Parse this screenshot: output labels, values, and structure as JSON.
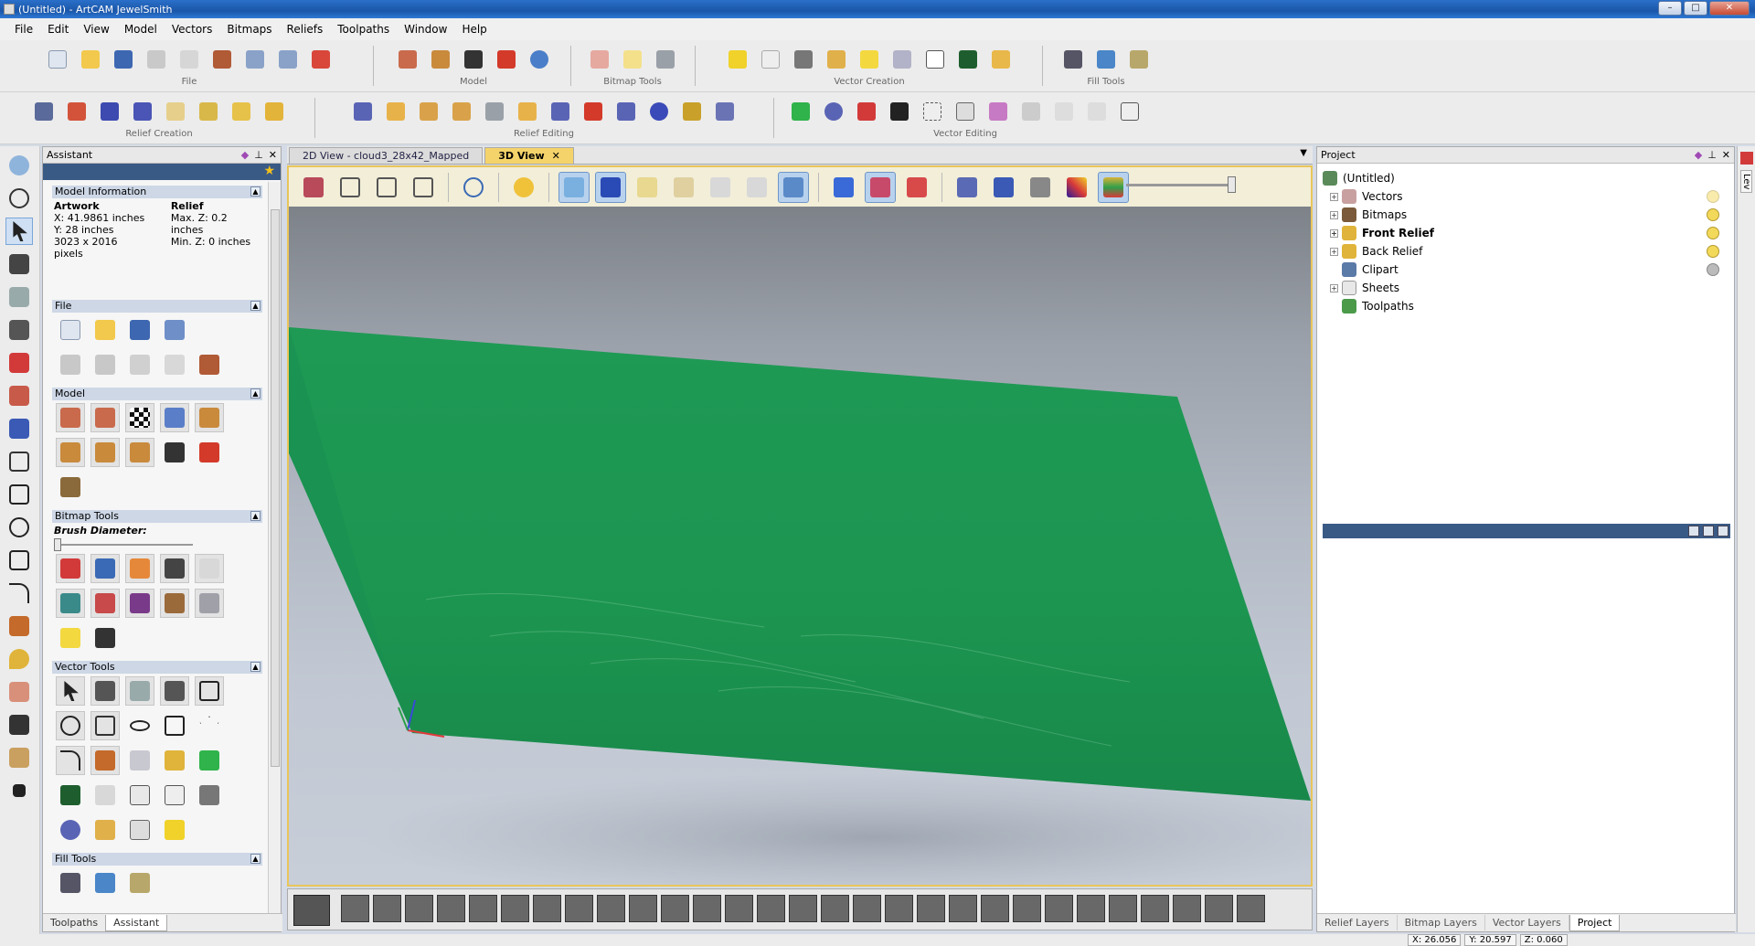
{
  "window": {
    "title": "(Untitled) - ArtCAM JewelSmith"
  },
  "menu": [
    "File",
    "Edit",
    "View",
    "Model",
    "Vectors",
    "Bitmaps",
    "Reliefs",
    "Toolpaths",
    "Window",
    "Help"
  ],
  "toolbar_groups": {
    "file": "File",
    "model": "Model",
    "bitmap_tools": "Bitmap Tools",
    "vector_creation": "Vector Creation",
    "fill_tools": "Fill Tools",
    "relief_creation": "Relief Creation",
    "relief_editing": "Relief Editing",
    "vector_editing": "Vector Editing"
  },
  "assistant": {
    "title": "Assistant",
    "model_info": {
      "heading": "Model Information",
      "artwork_label": "Artwork",
      "relief_label": "Relief",
      "x": "X: 41.9861 inches",
      "y": "Y: 28 inches",
      "pixels": "3023 x 2016 pixels",
      "max_z": "Max. Z: 0.2 inches",
      "min_z": "Min. Z: 0 inches"
    },
    "sections": {
      "file": "File",
      "model": "Model",
      "bitmap_tools": "Bitmap Tools",
      "brush_diameter": "Brush Diameter:",
      "vector_tools": "Vector Tools",
      "fill_tools": "Fill Tools"
    },
    "tabs": [
      "Toolpaths",
      "Assistant"
    ]
  },
  "view_tabs": [
    {
      "label": "2D View - cloud3_28x42_Mapped",
      "active": false
    },
    {
      "label": "3D View",
      "active": true
    }
  ],
  "project": {
    "title": "Project",
    "root": "(Untitled)",
    "items": [
      {
        "label": "Vectors",
        "bold": false
      },
      {
        "label": "Bitmaps",
        "bold": false
      },
      {
        "label": "Front Relief",
        "bold": true
      },
      {
        "label": "Back Relief",
        "bold": false
      },
      {
        "label": "Clipart",
        "bold": false
      },
      {
        "label": "Sheets",
        "bold": false
      },
      {
        "label": "Toolpaths",
        "bold": false
      }
    ],
    "tabs": [
      "Relief Layers",
      "Bitmap Layers",
      "Vector Layers",
      "Project"
    ]
  },
  "status": {
    "x": "X: 26.056",
    "y": "Y: 20.597",
    "z": "Z: 0.060"
  },
  "right_strip_label": "Lev",
  "colors": {
    "relief_green": "#1f9a55",
    "accent_blue": "#3a5a86",
    "tab_gold": "#f4d36a"
  }
}
